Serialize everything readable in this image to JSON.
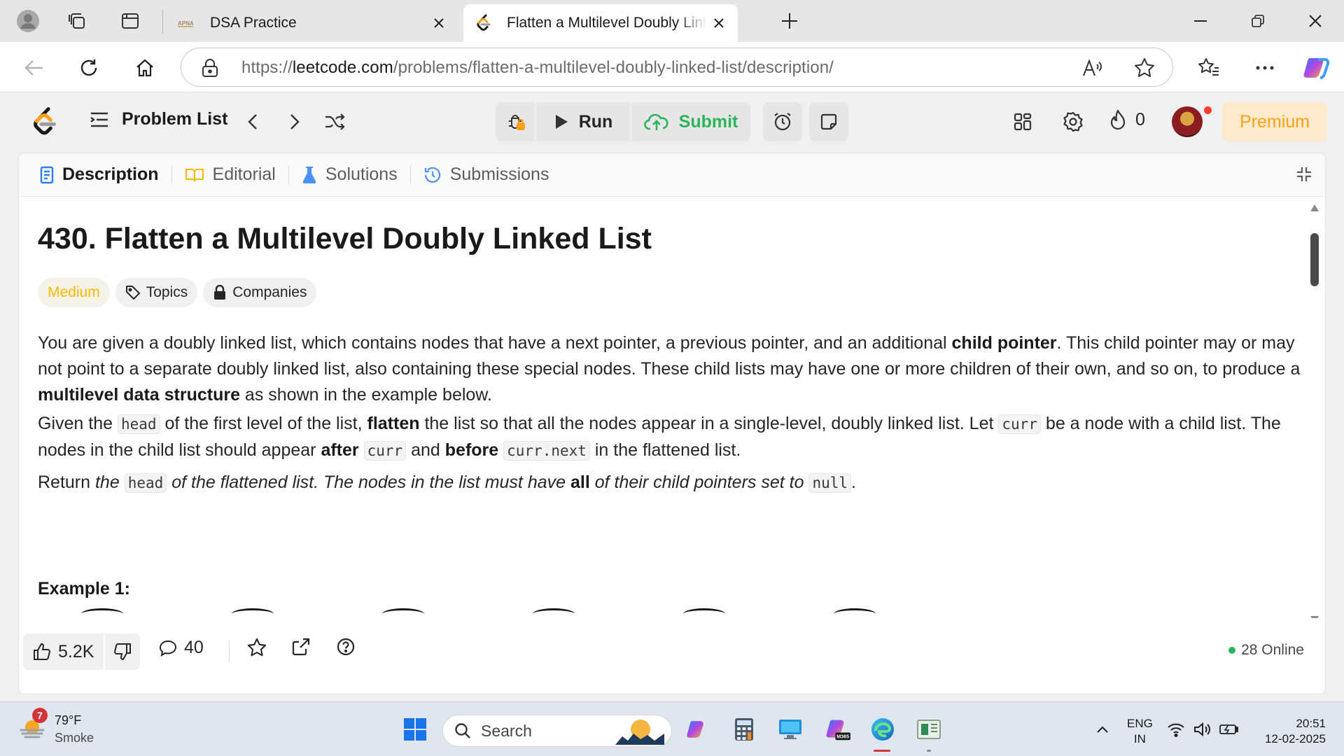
{
  "browser": {
    "tabs": [
      {
        "title": "DSA Practice",
        "favicon": "apna-logo"
      },
      {
        "title": "Flatten a Multilevel Doubly Linked List - LeetCode",
        "favicon": "leetcode-icon"
      }
    ],
    "url_prefix": "https://",
    "url_domain": "leetcode.com",
    "url_path": "/problems/flatten-a-multilevel-doubly-linked-list/description/"
  },
  "header": {
    "problem_list_label": "Problem List",
    "run_label": "Run",
    "submit_label": "Submit",
    "streak_count": "0",
    "premium_label": "Premium"
  },
  "panel": {
    "tabs": [
      {
        "label": "Description"
      },
      {
        "label": "Editorial"
      },
      {
        "label": "Solutions"
      },
      {
        "label": "Submissions"
      }
    ]
  },
  "problem": {
    "title": "430. Flatten a Multilevel Doubly Linked List",
    "difficulty": "Medium",
    "topics_label": "Topics",
    "companies_label": "Companies",
    "p1": {
      "t1": "You are given a doubly linked list, which contains nodes that have a next pointer, a previous pointer, and an additional ",
      "b1": "child pointer",
      "t2": ". This child pointer may or may not point to a separate doubly linked list, also containing these special nodes. These child lists may have one or more children of their own, and so on, to produce a ",
      "b2": "multilevel data structure",
      "t3": " as shown in the example below."
    },
    "p2": {
      "t1": "Given the ",
      "c1": "head",
      "t2": " of the first level of the list, ",
      "b1": "flatten",
      "t3": " the list so that all the nodes appear in a single-level, doubly linked list. Let ",
      "c2": "curr",
      "t4": " be a node with a child list. The nodes in the child list should appear ",
      "b2": "after",
      "c3": "curr",
      "t5": " and ",
      "b3": "before",
      "c4": "curr.next",
      "t6": " in the flattened list."
    },
    "p3": {
      "t1": "Return ",
      "i1": "the ",
      "c1": "head",
      "i2": " of the flattened list. The nodes in the list must have ",
      "b1": "all",
      "i3": " of their child pointers set to ",
      "c2": "null",
      "t2": "."
    },
    "example_title": "Example 1:"
  },
  "footer": {
    "likes": "5.2K",
    "comments": "40",
    "online": "28 Online"
  },
  "taskbar": {
    "weather_badge": "7",
    "temperature": "79°F",
    "condition": "Smoke",
    "search_placeholder": "Search",
    "lang_line1": "ENG",
    "lang_line2": "IN",
    "time": "20:51",
    "date": "12-02-2025"
  },
  "colors": {
    "leetcode_orange": "#ffa116",
    "submit_green": "#2db55d",
    "medium_yellow": "#ffb800",
    "online_green": "#2db55d"
  }
}
